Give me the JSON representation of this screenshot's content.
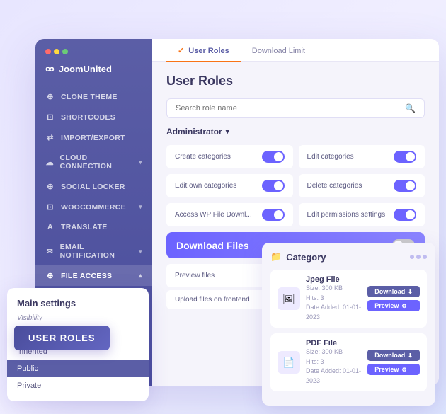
{
  "browser": {
    "dots": [
      "red",
      "yellow",
      "green"
    ],
    "logo_text": "JoomUnited"
  },
  "sidebar": {
    "items": [
      {
        "id": "clone-theme",
        "label": "CLONE THEME",
        "icon": "⊕"
      },
      {
        "id": "shortcodes",
        "label": "SHORTCODES",
        "icon": "⊡"
      },
      {
        "id": "import-export",
        "label": "IMPORT/EXPORT",
        "icon": "⇄"
      },
      {
        "id": "cloud-connection",
        "label": "CLOUD CONNECTION",
        "icon": "☁",
        "arrow": "▾"
      },
      {
        "id": "social-locker",
        "label": "SOCIAL LOCKER",
        "icon": "⊕"
      },
      {
        "id": "woocommerce",
        "label": "WOOCOMMERCE",
        "icon": "⊡",
        "arrow": "▾"
      },
      {
        "id": "translate",
        "label": "TRANSLATE",
        "icon": "A"
      },
      {
        "id": "email-notification",
        "label": "EMAIL NOTIFICATION",
        "icon": "✉",
        "arrow": "▾"
      },
      {
        "id": "file-access",
        "label": "FILE ACCESS",
        "icon": "⊕",
        "arrow": "▴",
        "active": true
      }
    ]
  },
  "user_roles_badge": "USER ROLES",
  "tabs": [
    {
      "id": "user-roles",
      "label": "User Roles",
      "active": true,
      "check": true
    },
    {
      "id": "download-limit",
      "label": "Download Limit",
      "active": false
    }
  ],
  "content": {
    "page_title": "User Roles",
    "search_placeholder": "Search role name",
    "admin_label": "Administrator",
    "permissions": [
      {
        "label": "Create categories",
        "enabled": true
      },
      {
        "label": "Edit categories",
        "enabled": true
      },
      {
        "label": "Edit own categories",
        "enabled": true
      },
      {
        "label": "Delete categories",
        "enabled": true
      },
      {
        "label": "Access WP File Downl...",
        "enabled": true
      },
      {
        "label": "Edit permissions settings",
        "enabled": true
      }
    ],
    "download_files_label": "Download Files",
    "download_files_enabled": false,
    "preview_files_label": "Preview files",
    "preview_files_enabled": true,
    "upload_files_label": "Upload files on frontend"
  },
  "main_settings": {
    "title": "Main settings",
    "visibility_label": "Visibility",
    "options": [
      {
        "id": "public1",
        "label": "Public"
      },
      {
        "id": "inherited",
        "label": "Inherited"
      },
      {
        "id": "public2",
        "label": "Public",
        "selected": true
      },
      {
        "id": "private",
        "label": "Private"
      }
    ]
  },
  "category_panel": {
    "title": "Category",
    "files": [
      {
        "id": "jpeg",
        "name": "Jpeg File",
        "size": "Size: 300 KB",
        "hits": "Hits: 3",
        "date": "Date Added: 01-01-2023",
        "icon": "🖼",
        "download_label": "Download",
        "preview_label": "Preview"
      },
      {
        "id": "pdf",
        "name": "PDF File",
        "size": "Size: 300 KB",
        "hits": "Hits: 3",
        "date": "Date Added: 01-01-2023",
        "icon": "📄",
        "download_label": "Download",
        "preview_label": "Preview"
      }
    ]
  }
}
